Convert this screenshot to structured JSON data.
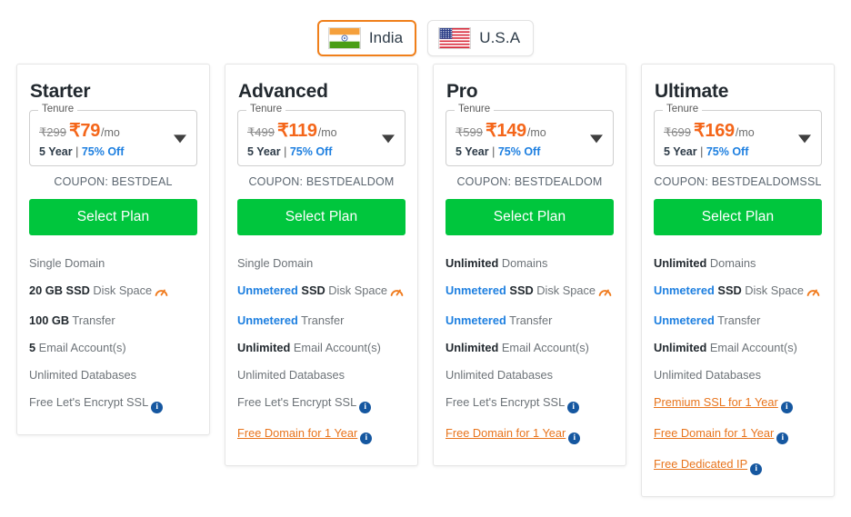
{
  "country_selector": {
    "options": [
      {
        "label": "India",
        "flag": "india-flag-icon",
        "selected": true
      },
      {
        "label": "U.S.A",
        "flag": "usa-flag-icon",
        "selected": false
      }
    ],
    "accent_color": "#f07f1a"
  },
  "colors": {
    "price_orange": "#f4661a",
    "link_orange": "#e8741c",
    "button_green": "#00c63d",
    "discount_blue": "#1d7fe0",
    "info_blue": "#1557a0",
    "gauge_orange": "#f07c1f",
    "text_gray": "#6d7378",
    "text_dark": "#22292f"
  },
  "tenure_label": "Tenure",
  "per_month_suffix": "/mo",
  "select_plan_label": "Select Plan",
  "plans": [
    {
      "name": "Starter",
      "old_price": "₹299",
      "new_price": "₹79",
      "term": "5 Year",
      "separator": " | ",
      "discount": "75% Off",
      "coupon": "COUPON: BESTDEAL",
      "features": [
        {
          "bold": "",
          "bold_color": "",
          "text": "Single Domain",
          "icon": ""
        },
        {
          "bold": "20 GB SSD",
          "bold_color": "dark",
          "text": " Disk Space",
          "icon": "gauge-icon"
        },
        {
          "bold": "100 GB",
          "bold_color": "dark",
          "text": " Transfer",
          "icon": ""
        },
        {
          "bold": "5",
          "bold_color": "dark",
          "text": " Email Account(s)",
          "icon": ""
        },
        {
          "bold": "",
          "bold_color": "",
          "text": "Unlimited Databases",
          "icon": ""
        },
        {
          "bold": "",
          "bold_color": "",
          "text": "Free Let's Encrypt SSL",
          "icon": "info-icon"
        }
      ]
    },
    {
      "name": "Advanced",
      "old_price": "₹499",
      "new_price": "₹119",
      "term": "5 Year",
      "separator": " | ",
      "discount": "75% Off",
      "coupon": "COUPON: BESTDEALDOM",
      "features": [
        {
          "bold": "",
          "bold_color": "",
          "text": "Single Domain",
          "icon": ""
        },
        {
          "bold": "Unmetered",
          "bold_color": "blue",
          "bold2": "SSD",
          "text": " Disk Space",
          "icon": "gauge-icon"
        },
        {
          "bold": "Unmetered",
          "bold_color": "blue",
          "text": " Transfer",
          "icon": ""
        },
        {
          "bold": "Unlimited",
          "bold_color": "dark",
          "text": " Email Account(s)",
          "icon": ""
        },
        {
          "bold": "",
          "bold_color": "",
          "text": "Unlimited Databases",
          "icon": ""
        },
        {
          "bold": "",
          "bold_color": "",
          "text": "Free Let's Encrypt SSL",
          "icon": "info-icon"
        },
        {
          "bold": "",
          "bold_color": "",
          "link": "Free Domain for 1 Year",
          "text": "",
          "icon": "info-icon"
        }
      ]
    },
    {
      "name": "Pro",
      "old_price": "₹599",
      "new_price": "₹149",
      "term": "5 Year",
      "separator": " | ",
      "discount": "75% Off",
      "coupon": "COUPON: BESTDEALDOM",
      "features": [
        {
          "bold": "Unlimited",
          "bold_color": "dark",
          "text": " Domains",
          "icon": ""
        },
        {
          "bold": "Unmetered",
          "bold_color": "blue",
          "bold2": "SSD",
          "text": " Disk Space",
          "icon": "gauge-icon"
        },
        {
          "bold": "Unmetered",
          "bold_color": "blue",
          "text": " Transfer",
          "icon": ""
        },
        {
          "bold": "Unlimited",
          "bold_color": "dark",
          "text": " Email Account(s)",
          "icon": ""
        },
        {
          "bold": "",
          "bold_color": "",
          "text": "Unlimited Databases",
          "icon": ""
        },
        {
          "bold": "",
          "bold_color": "",
          "text": "Free Let's Encrypt SSL",
          "icon": "info-icon"
        },
        {
          "bold": "",
          "bold_color": "",
          "link": "Free Domain for 1 Year",
          "text": "",
          "icon": "info-icon"
        }
      ]
    },
    {
      "name": "Ultimate",
      "old_price": "₹699",
      "new_price": "₹169",
      "term": "5 Year",
      "separator": " | ",
      "discount": "75% Off",
      "coupon": "COUPON: BESTDEALDOMSSL",
      "features": [
        {
          "bold": "Unlimited",
          "bold_color": "dark",
          "text": " Domains",
          "icon": ""
        },
        {
          "bold": "Unmetered",
          "bold_color": "blue",
          "bold2": "SSD",
          "text": " Disk Space",
          "icon": "gauge-icon"
        },
        {
          "bold": "Unmetered",
          "bold_color": "blue",
          "text": " Transfer",
          "icon": ""
        },
        {
          "bold": "Unlimited",
          "bold_color": "dark",
          "text": " Email Account(s)",
          "icon": ""
        },
        {
          "bold": "",
          "bold_color": "",
          "text": "Unlimited Databases",
          "icon": ""
        },
        {
          "bold": "",
          "bold_color": "",
          "link": "Premium SSL for 1 Year",
          "text": "",
          "icon": "info-icon"
        },
        {
          "bold": "",
          "bold_color": "",
          "link": "Free Domain for 1 Year",
          "text": "",
          "icon": "info-icon"
        },
        {
          "bold": "",
          "bold_color": "",
          "link": "Free Dedicated IP",
          "text": "",
          "icon": "info-icon"
        }
      ]
    }
  ]
}
